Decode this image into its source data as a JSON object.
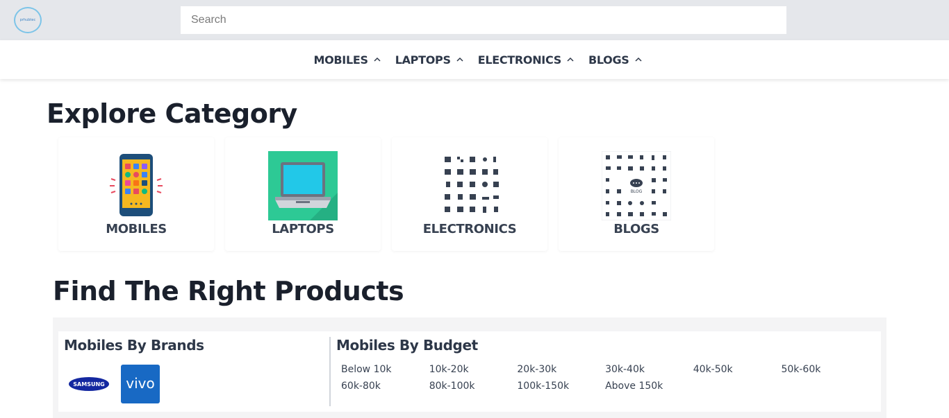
{
  "header": {
    "logo_text": "prhubtec",
    "search_placeholder": "Search"
  },
  "nav": {
    "items": [
      {
        "label": "MOBILES"
      },
      {
        "label": "LAPTOPS"
      },
      {
        "label": "ELECTRONICS"
      },
      {
        "label": "BLOGS"
      }
    ]
  },
  "explore": {
    "title": "Explore Category",
    "categories": [
      {
        "label": "MOBILES",
        "icon": "smartphone-apps-icon"
      },
      {
        "label": "LAPTOPS",
        "icon": "laptop-icon"
      },
      {
        "label": "ELECTRONICS",
        "icon": "electronics-icons-grid"
      },
      {
        "label": "BLOGS",
        "icon": "blog-icons-grid"
      }
    ]
  },
  "products": {
    "title": "Find The Right Products",
    "brands_title": "Mobiles By Brands",
    "brands": [
      {
        "name": "SAMSUNG",
        "color": "#1428a0"
      },
      {
        "name": "vivo",
        "color": "#1869c4"
      }
    ],
    "budget_title": "Mobiles By Budget",
    "budgets": [
      "Below 10k",
      "10k-20k",
      "20k-30k",
      "30k-40k",
      "40k-50k",
      "50k-60k",
      "60k-80k",
      "80k-100k",
      "100k-150k",
      "Above 150k"
    ]
  },
  "colors": {
    "header_bg": "#e5e7eb",
    "accent_blue": "#1869c4",
    "laptop_tile": "#2dc995"
  }
}
